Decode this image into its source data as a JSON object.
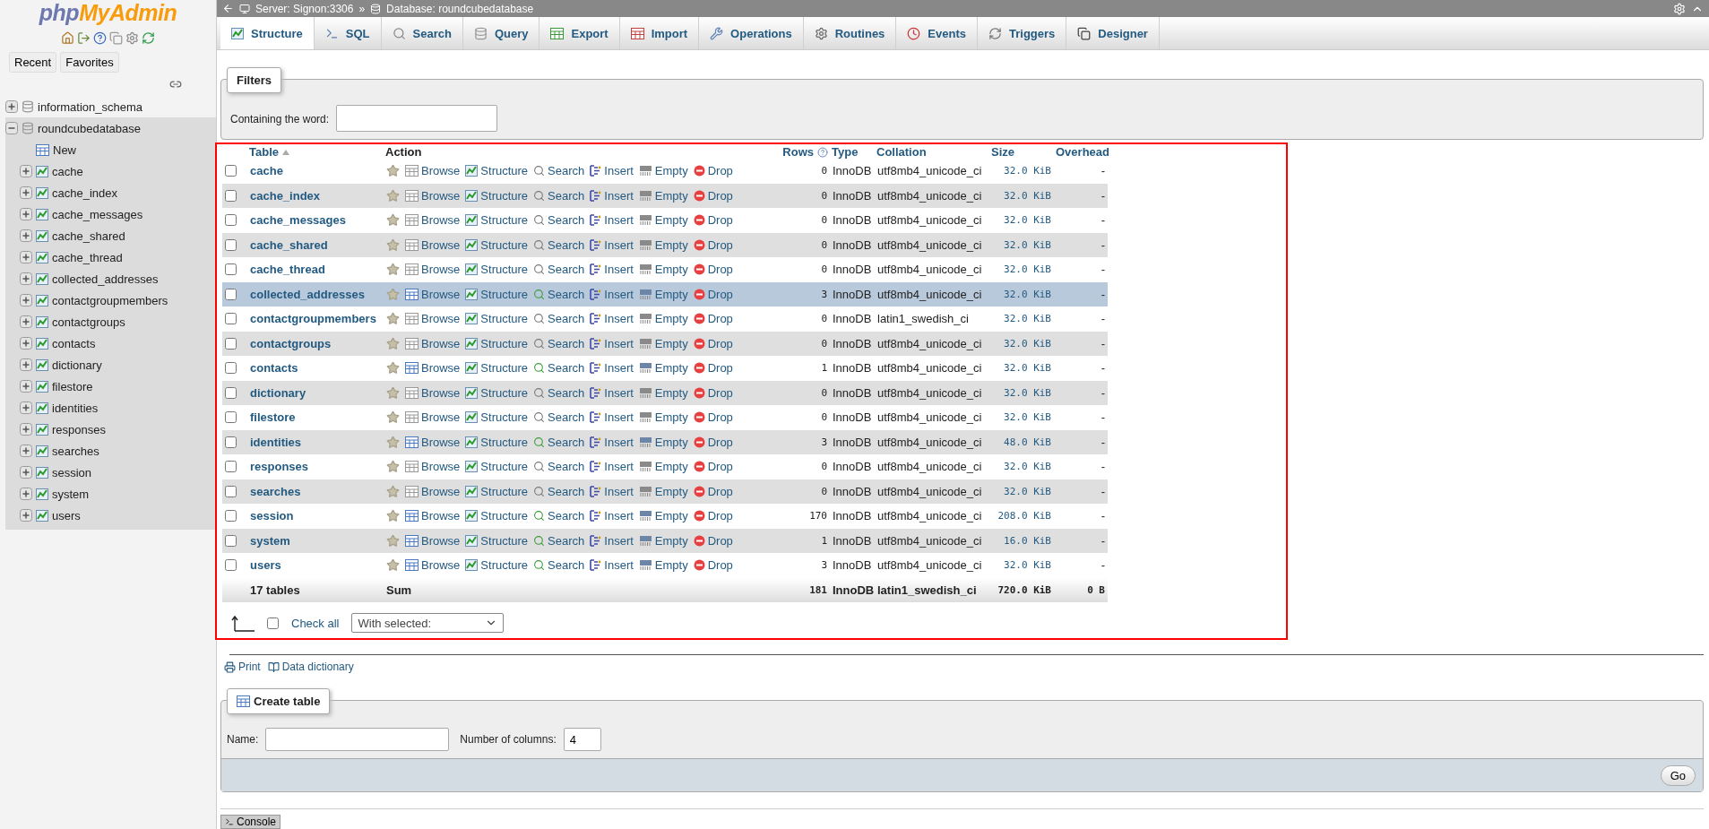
{
  "sidebar": {
    "logo": {
      "first": "php",
      "second": "MyAdmin"
    },
    "buttons": [
      "Recent",
      "Favorites"
    ],
    "tree": [
      {
        "label": "information_schema",
        "kind": "database",
        "expanded": false
      },
      {
        "label": "roundcubedatabase",
        "kind": "database",
        "expanded": true,
        "children": [
          {
            "label": "New",
            "kind": "new"
          },
          {
            "label": "cache",
            "kind": "table"
          },
          {
            "label": "cache_index",
            "kind": "table"
          },
          {
            "label": "cache_messages",
            "kind": "table"
          },
          {
            "label": "cache_shared",
            "kind": "table"
          },
          {
            "label": "cache_thread",
            "kind": "table"
          },
          {
            "label": "collected_addresses",
            "kind": "table"
          },
          {
            "label": "contactgroupmembers",
            "kind": "table"
          },
          {
            "label": "contactgroups",
            "kind": "table"
          },
          {
            "label": "contacts",
            "kind": "table"
          },
          {
            "label": "dictionary",
            "kind": "table"
          },
          {
            "label": "filestore",
            "kind": "table"
          },
          {
            "label": "identities",
            "kind": "table"
          },
          {
            "label": "responses",
            "kind": "table"
          },
          {
            "label": "searches",
            "kind": "table"
          },
          {
            "label": "session",
            "kind": "table"
          },
          {
            "label": "system",
            "kind": "table"
          },
          {
            "label": "users",
            "kind": "table"
          }
        ]
      }
    ]
  },
  "breadcrumb": {
    "server": "Server: Signon:3306",
    "separator": "»",
    "database": "Database: roundcubedatabase"
  },
  "tabs": [
    {
      "label": "Structure",
      "selected": true
    },
    {
      "label": "SQL",
      "selected": false
    },
    {
      "label": "Search",
      "selected": false
    },
    {
      "label": "Query",
      "selected": false
    },
    {
      "label": "Export",
      "selected": false
    },
    {
      "label": "Import",
      "selected": false
    },
    {
      "label": "Operations",
      "selected": false
    },
    {
      "label": "Routines",
      "selected": false
    },
    {
      "label": "Events",
      "selected": false
    },
    {
      "label": "Triggers",
      "selected": false
    },
    {
      "label": "Designer",
      "selected": false
    }
  ],
  "filters": {
    "legend": "Filters",
    "label": "Containing the word:"
  },
  "table": {
    "columns": [
      "Table",
      "Action",
      "Rows",
      "Type",
      "Collation",
      "Size",
      "Overhead"
    ],
    "rows": [
      {
        "name": "cache",
        "actions": [
          "Browse",
          "Structure",
          "Search",
          "Insert",
          "Empty",
          "Drop"
        ],
        "rows": "0",
        "type": "InnoDB",
        "collation": "utf8mb4_unicode_ci",
        "size": "32.0 KiB",
        "overhead": "-",
        "checked": false,
        "highlighted": false,
        "has_rows": false
      },
      {
        "name": "cache_index",
        "actions": [
          "Browse",
          "Structure",
          "Search",
          "Insert",
          "Empty",
          "Drop"
        ],
        "rows": "0",
        "type": "InnoDB",
        "collation": "utf8mb4_unicode_ci",
        "size": "32.0 KiB",
        "overhead": "-",
        "checked": false,
        "highlighted": false,
        "has_rows": false
      },
      {
        "name": "cache_messages",
        "actions": [
          "Browse",
          "Structure",
          "Search",
          "Insert",
          "Empty",
          "Drop"
        ],
        "rows": "0",
        "type": "InnoDB",
        "collation": "utf8mb4_unicode_ci",
        "size": "32.0 KiB",
        "overhead": "-",
        "checked": false,
        "highlighted": false,
        "has_rows": false
      },
      {
        "name": "cache_shared",
        "actions": [
          "Browse",
          "Structure",
          "Search",
          "Insert",
          "Empty",
          "Drop"
        ],
        "rows": "0",
        "type": "InnoDB",
        "collation": "utf8mb4_unicode_ci",
        "size": "32.0 KiB",
        "overhead": "-",
        "checked": false,
        "highlighted": false,
        "has_rows": false
      },
      {
        "name": "cache_thread",
        "actions": [
          "Browse",
          "Structure",
          "Search",
          "Insert",
          "Empty",
          "Drop"
        ],
        "rows": "0",
        "type": "InnoDB",
        "collation": "utf8mb4_unicode_ci",
        "size": "32.0 KiB",
        "overhead": "-",
        "checked": false,
        "highlighted": false,
        "has_rows": false
      },
      {
        "name": "collected_addresses",
        "actions": [
          "Browse",
          "Structure",
          "Search",
          "Insert",
          "Empty",
          "Drop"
        ],
        "rows": "3",
        "type": "InnoDB",
        "collation": "utf8mb4_unicode_ci",
        "size": "32.0 KiB",
        "overhead": "-",
        "checked": false,
        "highlighted": true,
        "has_rows": true
      },
      {
        "name": "contactgroupmembers",
        "actions": [
          "Browse",
          "Structure",
          "Search",
          "Insert",
          "Empty",
          "Drop"
        ],
        "rows": "0",
        "type": "InnoDB",
        "collation": "latin1_swedish_ci",
        "size": "32.0 KiB",
        "overhead": "-",
        "checked": false,
        "highlighted": false,
        "has_rows": false
      },
      {
        "name": "contactgroups",
        "actions": [
          "Browse",
          "Structure",
          "Search",
          "Insert",
          "Empty",
          "Drop"
        ],
        "rows": "0",
        "type": "InnoDB",
        "collation": "utf8mb4_unicode_ci",
        "size": "32.0 KiB",
        "overhead": "-",
        "checked": false,
        "highlighted": false,
        "has_rows": false
      },
      {
        "name": "contacts",
        "actions": [
          "Browse",
          "Structure",
          "Search",
          "Insert",
          "Empty",
          "Drop"
        ],
        "rows": "1",
        "type": "InnoDB",
        "collation": "utf8mb4_unicode_ci",
        "size": "32.0 KiB",
        "overhead": "-",
        "checked": false,
        "highlighted": false,
        "has_rows": true
      },
      {
        "name": "dictionary",
        "actions": [
          "Browse",
          "Structure",
          "Search",
          "Insert",
          "Empty",
          "Drop"
        ],
        "rows": "0",
        "type": "InnoDB",
        "collation": "utf8mb4_unicode_ci",
        "size": "32.0 KiB",
        "overhead": "-",
        "checked": false,
        "highlighted": false,
        "has_rows": false
      },
      {
        "name": "filestore",
        "actions": [
          "Browse",
          "Structure",
          "Search",
          "Insert",
          "Empty",
          "Drop"
        ],
        "rows": "0",
        "type": "InnoDB",
        "collation": "utf8mb4_unicode_ci",
        "size": "32.0 KiB",
        "overhead": "-",
        "checked": false,
        "highlighted": false,
        "has_rows": false
      },
      {
        "name": "identities",
        "actions": [
          "Browse",
          "Structure",
          "Search",
          "Insert",
          "Empty",
          "Drop"
        ],
        "rows": "3",
        "type": "InnoDB",
        "collation": "utf8mb4_unicode_ci",
        "size": "48.0 KiB",
        "overhead": "-",
        "checked": false,
        "highlighted": false,
        "has_rows": true
      },
      {
        "name": "responses",
        "actions": [
          "Browse",
          "Structure",
          "Search",
          "Insert",
          "Empty",
          "Drop"
        ],
        "rows": "0",
        "type": "InnoDB",
        "collation": "utf8mb4_unicode_ci",
        "size": "32.0 KiB",
        "overhead": "-",
        "checked": false,
        "highlighted": false,
        "has_rows": false
      },
      {
        "name": "searches",
        "actions": [
          "Browse",
          "Structure",
          "Search",
          "Insert",
          "Empty",
          "Drop"
        ],
        "rows": "0",
        "type": "InnoDB",
        "collation": "utf8mb4_unicode_ci",
        "size": "32.0 KiB",
        "overhead": "-",
        "checked": false,
        "highlighted": false,
        "has_rows": false
      },
      {
        "name": "session",
        "actions": [
          "Browse",
          "Structure",
          "Search",
          "Insert",
          "Empty",
          "Drop"
        ],
        "rows": "170",
        "type": "InnoDB",
        "collation": "utf8mb4_unicode_ci",
        "size": "208.0 KiB",
        "overhead": "-",
        "checked": false,
        "highlighted": false,
        "has_rows": true
      },
      {
        "name": "system",
        "actions": [
          "Browse",
          "Structure",
          "Search",
          "Insert",
          "Empty",
          "Drop"
        ],
        "rows": "1",
        "type": "InnoDB",
        "collation": "utf8mb4_unicode_ci",
        "size": "16.0 KiB",
        "overhead": "-",
        "checked": false,
        "highlighted": false,
        "has_rows": true
      },
      {
        "name": "users",
        "actions": [
          "Browse",
          "Structure",
          "Search",
          "Insert",
          "Empty",
          "Drop"
        ],
        "rows": "3",
        "type": "InnoDB",
        "collation": "utf8mb4_unicode_ci",
        "size": "32.0 KiB",
        "overhead": "-",
        "checked": false,
        "highlighted": false,
        "has_rows": true
      }
    ],
    "footer": {
      "count": "17 tables",
      "sum": "Sum",
      "rows": "181",
      "type": "InnoDB",
      "collation": "latin1_swedish_ci",
      "size": "720.0 KiB",
      "overhead": "0 B"
    }
  },
  "check_all": {
    "label": "Check all",
    "checked": false
  },
  "with_selected": "With selected:",
  "links": [
    "Print",
    "Data dictionary"
  ],
  "create_table": {
    "legend": "Create table",
    "name_label": "Name:",
    "columns_label": "Number of columns:",
    "columns_value": "4",
    "go": "Go"
  },
  "console": "Console"
}
